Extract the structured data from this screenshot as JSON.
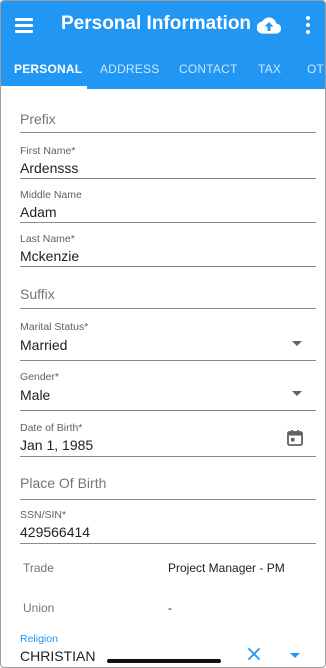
{
  "header": {
    "title": "Personal Information"
  },
  "icons": {
    "menu": "menu-icon",
    "upload": "cloud-upload-icon",
    "more": "more-vert-icon",
    "calendar": "calendar-icon",
    "clear": "close-icon"
  },
  "colors": {
    "primary": "#2196f3",
    "text": "#212121",
    "label": "#616161"
  },
  "tabs": [
    {
      "label": "PERSONAL",
      "active": true
    },
    {
      "label": "ADDRESS",
      "active": false
    },
    {
      "label": "CONTACT",
      "active": false
    },
    {
      "label": "TAX",
      "active": false
    },
    {
      "label": "OTH",
      "active": false
    }
  ],
  "form": {
    "prefix": {
      "placeholder": "Prefix"
    },
    "first_name": {
      "label": "First Name*",
      "value": "Ardensss"
    },
    "middle_name": {
      "label": "Middle Name",
      "value": "Adam"
    },
    "last_name": {
      "label": "Last Name*",
      "value": "Mckenzie"
    },
    "suffix": {
      "placeholder": "Suffix"
    },
    "marital_status": {
      "label": "Marital Status*",
      "value": "Married"
    },
    "gender": {
      "label": "Gender*",
      "value": "Male"
    },
    "dob": {
      "label": "Date of Birth*",
      "value": "Jan 1, 1985"
    },
    "place_of_birth": {
      "placeholder": "Place Of Birth"
    },
    "ssn": {
      "label": "SSN/SIN*",
      "value": "429566414"
    },
    "trade": {
      "label": "Trade",
      "value": "Project Manager - PM"
    },
    "union": {
      "label": "Union",
      "value": "-"
    },
    "religion": {
      "label": "Religion",
      "value": "CHRISTIAN"
    }
  }
}
